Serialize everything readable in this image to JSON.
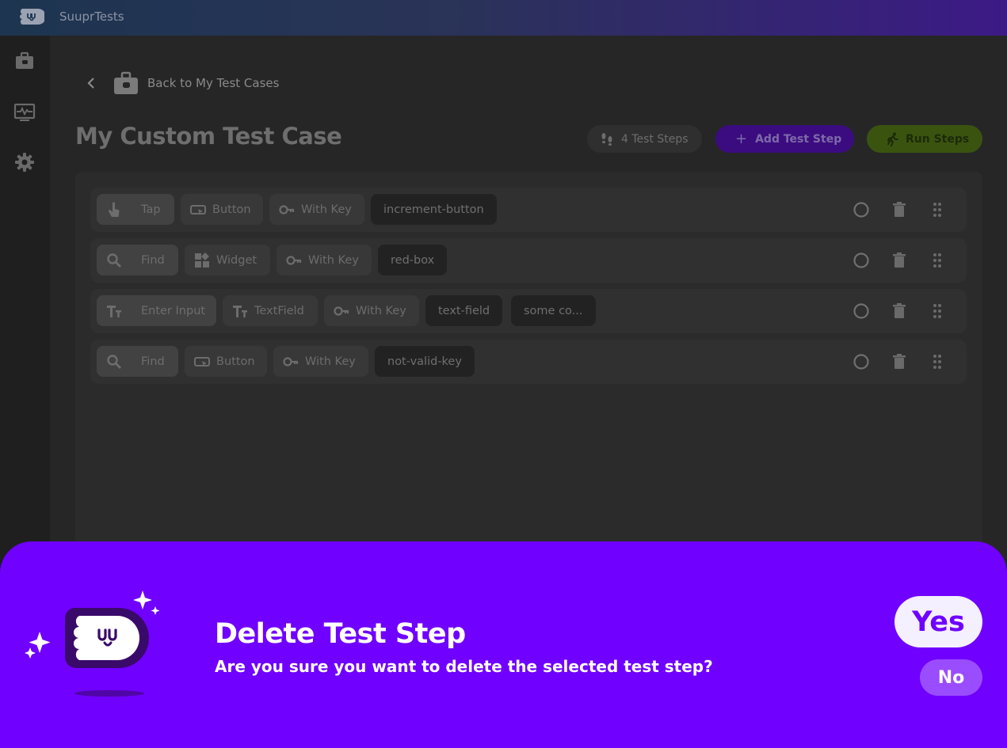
{
  "app": {
    "title": "SuuprTests"
  },
  "sidebar": {
    "items": [
      {
        "icon": "briefcase-icon"
      },
      {
        "icon": "monitor-pulse-icon"
      },
      {
        "icon": "gear-icon"
      }
    ]
  },
  "header": {
    "back_label": "Back to My Test Cases",
    "page_title": "My Custom Test Case",
    "steps_count_label": "4 Test Steps",
    "add_step_label": "Add Test Step",
    "run_steps_label": "Run Steps"
  },
  "steps": [
    {
      "action": "Tap",
      "action_icon": "tap-hand-icon",
      "target": "Button",
      "target_icon": "button-icon",
      "key_label": "With Key",
      "values": [
        "increment-button"
      ]
    },
    {
      "action": "Find",
      "action_icon": "search-icon",
      "target": "Widget",
      "target_icon": "widget-icon",
      "key_label": "With Key",
      "values": [
        "red-box"
      ]
    },
    {
      "action": "Enter Input",
      "action_icon": "text-icon",
      "target": "TextField",
      "target_icon": "text-icon",
      "key_label": "With Key",
      "values": [
        "text-field",
        "some co..."
      ]
    },
    {
      "action": "Find",
      "action_icon": "search-icon",
      "target": "Button",
      "target_icon": "button-icon",
      "key_label": "With Key",
      "values": [
        "not-valid-key"
      ]
    }
  ],
  "dialog": {
    "title": "Delete Test Step",
    "message": "Are you sure you want to delete the selected test step?",
    "yes_label": "Yes",
    "no_label": "No"
  },
  "colors": {
    "accent_purple": "#7000ff",
    "run_green": "#3a5410",
    "add_purple": "#3b0c80"
  }
}
